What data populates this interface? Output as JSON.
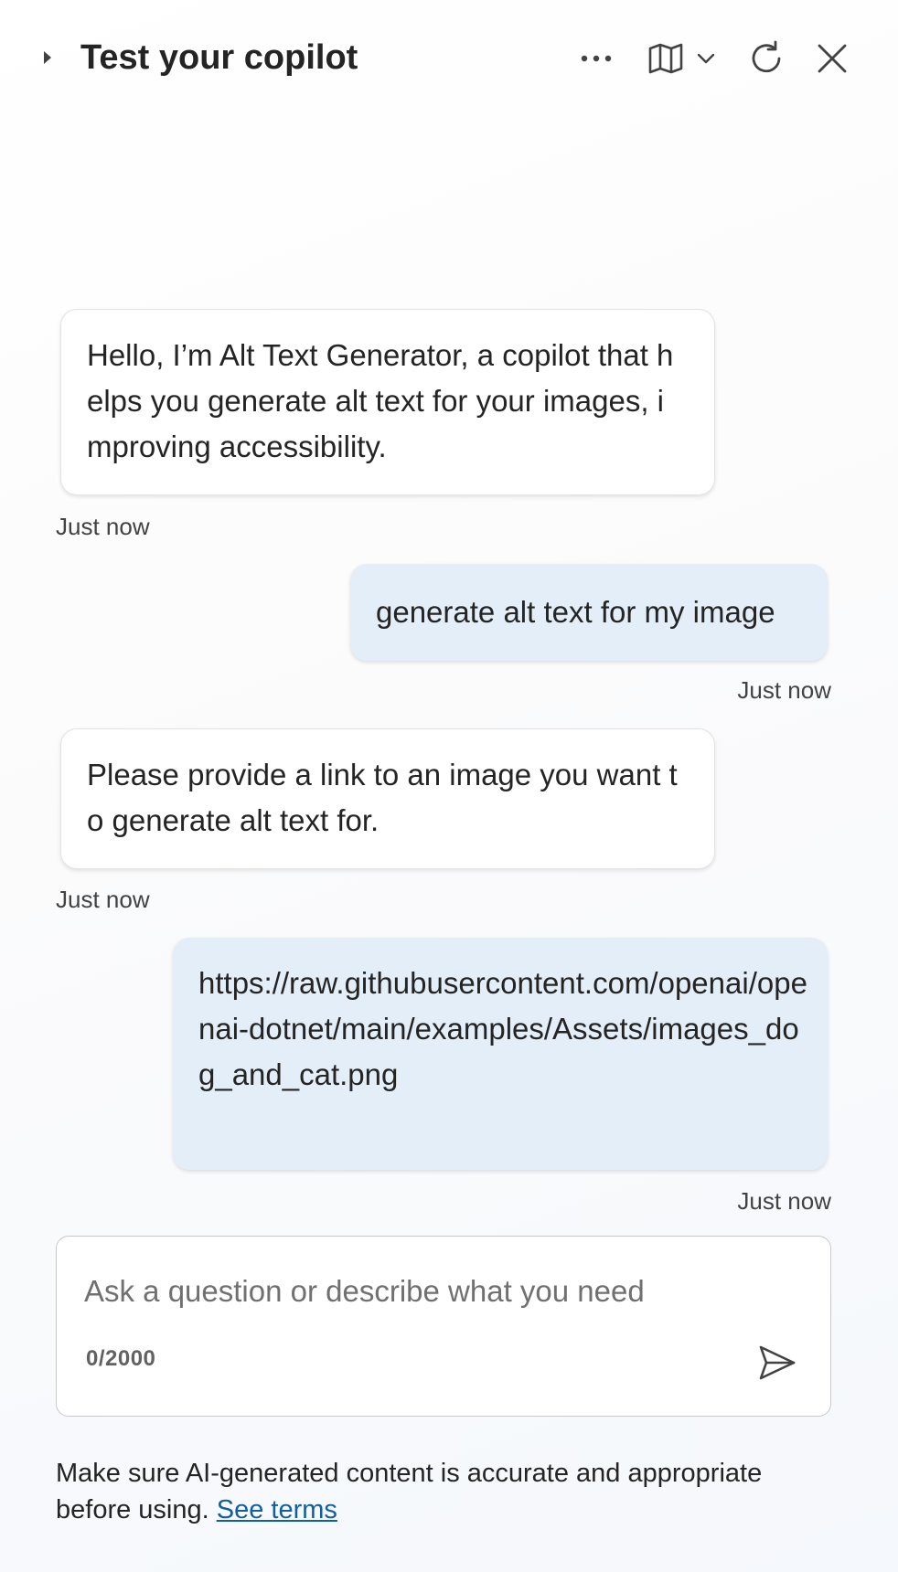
{
  "header": {
    "title": "Test your copilot",
    "icons": {
      "toggle": "caret-right-icon",
      "more": "more-horizontal-icon",
      "map": "map-icon",
      "chevron": "chevron-down-icon",
      "refresh": "refresh-icon",
      "close": "close-icon"
    }
  },
  "conversation": [
    {
      "role": "bot",
      "text": "Hello, I’m Alt Text Generator, a copilot that helps you generate alt text for your images, improving accessibility.",
      "timestamp": "Just now"
    },
    {
      "role": "user",
      "text": "generate alt text for my image",
      "timestamp": "Just now"
    },
    {
      "role": "bot",
      "text": "Please provide a link to an image you want to generate alt text for.",
      "timestamp": "Just now"
    },
    {
      "role": "user",
      "text": "https://raw.githubusercontent.com/openai/openai-dotnet/main/examples/Assets/images_dog_and_cat.png",
      "timestamp": "Just now"
    }
  ],
  "composer": {
    "placeholder": "Ask a question or describe what you need",
    "value": "",
    "counter": "0/2000",
    "send_icon": "send-icon"
  },
  "footer": {
    "disclaimer": "Make sure AI-generated content is accurate and appropriate before using.",
    "link_label": "See terms"
  },
  "colors": {
    "user_bubble": "#e4eef8",
    "bot_bubble": "#ffffff",
    "link": "#115ea3"
  }
}
